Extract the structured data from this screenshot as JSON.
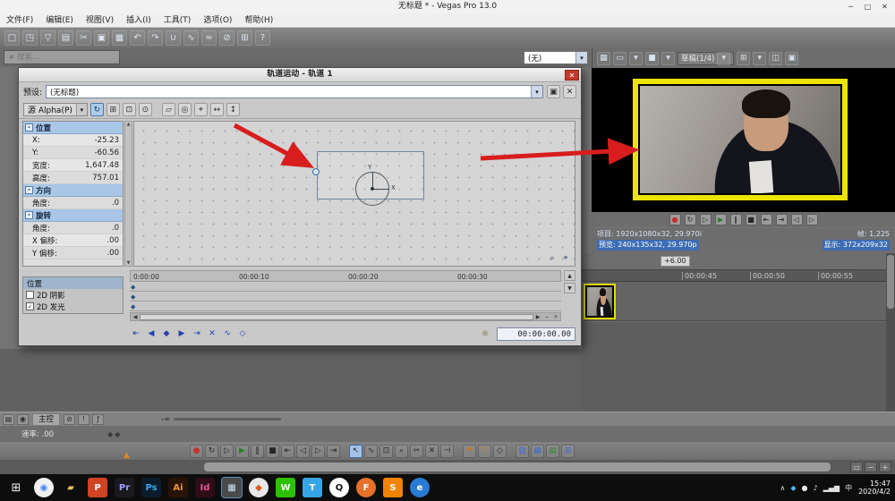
{
  "glyphs": {
    "dropdown": "▾",
    "check": "✓",
    "collapse": "-",
    "up": "▲",
    "down": "▼",
    "left": "◀",
    "right": "▶",
    "magnifier": "⌕",
    "pan": "⌖",
    "lamp": "☼",
    "box": "▭",
    "minus": "−",
    "plus": "+",
    "marker": "▲",
    "diamonds": "◆◆",
    "start": "⊞"
  },
  "window": {
    "title": "无标题 * - Vegas Pro 13.0",
    "controls": [
      {
        "name": "minimize-button",
        "t": "─",
        "cls": "winbtn"
      },
      {
        "name": "maximize-button",
        "t": "□",
        "cls": "winbtn"
      },
      {
        "name": "close-button",
        "t": "✕",
        "cls": "winbtn"
      }
    ],
    "menus": [
      {
        "name": "menu-file",
        "t": "文件(F)",
        "cls": "menu"
      },
      {
        "name": "menu-edit",
        "t": "编辑(E)",
        "cls": "menu"
      },
      {
        "name": "menu-view",
        "t": "视图(V)",
        "cls": "menu"
      },
      {
        "name": "menu-insert",
        "t": "插入(I)",
        "cls": "menu"
      },
      {
        "name": "menu-tools",
        "t": "工具(T)",
        "cls": "menu"
      },
      {
        "name": "menu-options",
        "t": "选项(O)",
        "cls": "menu"
      },
      {
        "name": "menu-help",
        "t": "帮助(H)",
        "cls": "menu"
      }
    ]
  },
  "main_toolbar": {
    "icons": [
      {
        "name": "new-project-icon",
        "t": "□"
      },
      {
        "name": "open-icon",
        "t": "◳"
      },
      {
        "name": "save-icon",
        "t": "▽"
      },
      {
        "name": "project-properties-icon",
        "t": "▤"
      },
      {
        "name": "cut-icon",
        "t": "✂"
      },
      {
        "name": "copy-icon",
        "t": "▣"
      },
      {
        "name": "paste-icon",
        "t": "▦"
      },
      {
        "name": "undo-icon",
        "t": "↶"
      },
      {
        "name": "redo-icon",
        "t": "↷"
      },
      {
        "name": "enable-snapping-icon",
        "t": "∪"
      },
      {
        "name": "auto-crossfade-icon",
        "t": "∿"
      },
      {
        "name": "auto-ripple-icon",
        "t": "≈"
      },
      {
        "name": "lock-envelopes-icon",
        "t": "⊘"
      },
      {
        "name": "ignore-grouping-icon",
        "t": "⊞"
      },
      {
        "name": "whats-this-help-icon",
        "t": "?"
      }
    ]
  },
  "subrow": {
    "search_placeholder": "搜索...",
    "none_dropdown": "(无)"
  },
  "dialog": {
    "title": "轨道运动 - 轨道 1",
    "close_glyph": "✕",
    "preset_label": "预设:",
    "preset_value": "(无标题)",
    "preset_icons": [
      {
        "name": "save-preset-icon",
        "t": "▣"
      },
      {
        "name": "delete-preset-icon",
        "t": "✕"
      }
    ],
    "alpha_combo": "源 Alpha(P)",
    "alpha_icons": [
      {
        "name": "sync-cursor-icon",
        "t": "↻",
        "cls": "on"
      },
      {
        "name": "prevent-movement-icon",
        "t": "⊞"
      },
      {
        "name": "prevent-scaling-icon",
        "t": "⊡"
      },
      {
        "name": "prevent-rotation-icon",
        "t": "⊙"
      },
      {
        "name": "separator",
        "t": "",
        "cls": "sep",
        "inter": false
      },
      {
        "name": "lock-aspect-ratio-icon",
        "t": "▱"
      },
      {
        "name": "scale-about-center-icon",
        "t": "◎"
      },
      {
        "name": "move-freely-icon",
        "t": "⌖"
      },
      {
        "name": "move-x-only-icon",
        "t": "↔"
      },
      {
        "name": "move-y-only-icon",
        "t": "↕"
      }
    ],
    "properties": [
      {
        "type": "header",
        "id": "position",
        "label": "位置"
      },
      {
        "type": "row",
        "label": "X:",
        "value": "-25.23"
      },
      {
        "type": "row",
        "label": "Y:",
        "value": "-60.56"
      },
      {
        "type": "row",
        "label": "宽度:",
        "value": "1,647.48"
      },
      {
        "type": "row",
        "label": "高度:",
        "value": "757.01"
      },
      {
        "type": "header",
        "id": "orientation",
        "label": "方向"
      },
      {
        "type": "row",
        "label": "角度:",
        "value": ".0"
      },
      {
        "type": "header",
        "id": "rotation",
        "label": "旋转"
      },
      {
        "type": "row",
        "label": "角度:",
        "value": ".0"
      },
      {
        "type": "row",
        "label": "X 偏移:",
        "value": ".00"
      },
      {
        "type": "row",
        "label": "Y 偏移:",
        "value": ".00"
      }
    ],
    "canvas": {
      "axis_y": "Y",
      "axis_x": "X"
    },
    "position_list": {
      "title": "位置",
      "items": [
        "2D 阴影",
        "2D 发光"
      ]
    },
    "ruler_ticks": [
      "0:00:00",
      "00:00:10",
      "00:00:20",
      "00:00:30"
    ],
    "keyframe_nav": [
      {
        "name": "go-to-first-keyframe-icon",
        "t": "⇤",
        "cls": "kf"
      },
      {
        "name": "previous-keyframe-icon",
        "t": "◀",
        "cls": "kf"
      },
      {
        "name": "insert-keyframe-icon",
        "t": "◆",
        "cls": "kf"
      },
      {
        "name": "next-keyframe-icon",
        "t": "▶",
        "cls": "kf"
      },
      {
        "name": "go-to-last-keyframe-icon",
        "t": "⇥",
        "cls": "kf"
      },
      {
        "name": "delete-keyframe-icon",
        "t": "✕",
        "cls": "kf"
      },
      {
        "name": "keyframe-interpolation-icon",
        "t": "∿",
        "cls": "kf"
      },
      {
        "name": "sync-keyframe-cursor-icon",
        "t": "◇",
        "cls": "kf"
      }
    ],
    "timecode": "00:00:00.00"
  },
  "preview": {
    "toolbar_icons_left": [
      {
        "name": "preview-device-icon",
        "t": "▦"
      },
      {
        "name": "video-output-icon",
        "t": "▭"
      },
      {
        "name": "output-dropdown-icon",
        "t": "▾"
      },
      {
        "name": "overlay-icon",
        "t": "■"
      },
      {
        "name": "overlay-dropdown-icon",
        "t": "▾"
      }
    ],
    "quality_label": "草稿(1/4)",
    "toolbar_icons_right": [
      {
        "name": "preview-grid-icon",
        "t": "⊞"
      },
      {
        "name": "grid-dropdown-icon",
        "t": "▾"
      },
      {
        "name": "split-screen-icon",
        "t": "◫"
      },
      {
        "name": "copy-snapshot-icon",
        "t": "▣"
      }
    ],
    "transport": [
      {
        "name": "record-button",
        "t": "●",
        "fg": "#c83030"
      },
      {
        "name": "loop-playback-button",
        "t": "↻"
      },
      {
        "name": "play-from-start-button",
        "t": "▷"
      },
      {
        "name": "play-button",
        "t": "▶",
        "fg": "#2e7d2e"
      },
      {
        "name": "pause-button",
        "t": "‖"
      },
      {
        "name": "stop-button",
        "t": "■"
      },
      {
        "name": "go-to-start-button",
        "t": "⇤"
      },
      {
        "name": "go-to-end-button",
        "t": "⇥"
      },
      {
        "name": "previous-frame-button",
        "t": "◁"
      },
      {
        "name": "next-frame-button",
        "t": "▷"
      }
    ],
    "info": {
      "project_label": "项目:",
      "project_value": "1920x1080x32, 29.970i",
      "frames_label": "帧:",
      "frames_value": "1,225",
      "preview_label": "预览:",
      "preview_value": "240x135x32, 29.970p",
      "display_label": "显示:",
      "display_value": "372x209x32"
    }
  },
  "timeline": {
    "offset_label": "+6.00",
    "ruler_ticks": [
      "00:00:45",
      "00:00:50",
      "00:00:55"
    ]
  },
  "bottom": {
    "master_icons": [
      {
        "name": "track-list-grid-icon",
        "t": "▤"
      },
      {
        "name": "bus-arm-icon",
        "t": "◉"
      }
    ],
    "master_label": "主控",
    "master_fx_icons": [
      {
        "name": "mute-icon",
        "t": "⊘"
      },
      {
        "name": "solo-icon",
        "t": "!"
      },
      {
        "name": "bus-fx-icon",
        "t": "ƒ"
      }
    ],
    "master_db": "-∞",
    "rate_label": "速率: .00",
    "transport": [
      {
        "name": "record-button",
        "t": "●",
        "fg": "#c83030"
      },
      {
        "name": "loop-playback-button",
        "t": "↻"
      },
      {
        "name": "play-from-start-button",
        "t": "▷"
      },
      {
        "name": "play-button",
        "t": "▶",
        "fg": "#2e7d2e"
      },
      {
        "name": "pause-button",
        "t": "‖"
      },
      {
        "name": "stop-button",
        "t": "■"
      },
      {
        "name": "go-to-start-button",
        "t": "⇤"
      },
      {
        "name": "previous-frame-button",
        "t": "◁"
      },
      {
        "name": "next-frame-button",
        "t": "▷"
      },
      {
        "name": "go-to-end-button",
        "t": "⇥"
      },
      {
        "name": "separator",
        "t": "",
        "cls": "sep",
        "inter": false
      },
      {
        "name": "normal-edit-tool-icon",
        "t": "↖",
        "cls": "on"
      },
      {
        "name": "envelope-edit-tool-icon",
        "t": "∿"
      },
      {
        "name": "selection-edit-tool-icon",
        "t": "⊡"
      },
      {
        "name": "zoom-edit-tool-icon",
        "t": "⌕"
      },
      {
        "name": "split-event-icon",
        "t": "✂"
      },
      {
        "name": "delete-event-icon",
        "t": "✕"
      },
      {
        "name": "trim-event-icon",
        "t": "⊣"
      },
      {
        "name": "separator",
        "t": "",
        "cls": "sep",
        "inter": false
      },
      {
        "name": "insert-marker-icon",
        "t": "⚑",
        "fg": "#c87820"
      },
      {
        "name": "insert-region-icon",
        "t": "▽",
        "fg": "#c87820"
      },
      {
        "name": "insert-command-icon",
        "t": "◇"
      },
      {
        "name": "separator",
        "t": "",
        "cls": "sep",
        "inter": false
      },
      {
        "name": "mixer-window-icon",
        "t": "▥",
        "fg": "#3c6cd0"
      },
      {
        "name": "video-preview-window-icon",
        "t": "▦",
        "fg": "#3c6cd0"
      },
      {
        "name": "master-bus-window-icon",
        "t": "▤",
        "fg": "#2e8a2e"
      },
      {
        "name": "plugin-manager-icon",
        "t": "⊞",
        "fg": "#3c6cd0"
      }
    ]
  },
  "taskbar": {
    "apps": [
      {
        "name": "taskbar-chrome-icon",
        "t": "◉",
        "bg": "#f1f1f1",
        "fg": "#4285f4",
        "cls": "round"
      },
      {
        "name": "taskbar-folder-icon",
        "t": "▰",
        "fg": "#e8c04a"
      },
      {
        "name": "taskbar-powerpoint-icon",
        "t": "P",
        "bg": "#d04423",
        "fg": "#ffffff"
      },
      {
        "name": "taskbar-premiere-icon",
        "t": "Pr",
        "bg": "#19191f",
        "fg": "#9f9fff"
      },
      {
        "name": "taskbar-photoshop-icon",
        "t": "Ps",
        "bg": "#0b1d2c",
        "fg": "#38a8e8"
      },
      {
        "name": "taskbar-illustrator-icon",
        "t": "Ai",
        "bg": "#271407",
        "fg": "#f09434"
      },
      {
        "name": "taskbar-indesign-icon",
        "t": "Id",
        "bg": "#2e0c18",
        "fg": "#e85590"
      },
      {
        "name": "taskbar-vegas-icon",
        "t": "▦",
        "bg": "#4a4a4a",
        "fg": "#cfe2f2",
        "cls": "active"
      },
      {
        "name": "taskbar-kmplayer-icon",
        "t": "◆",
        "bg": "#e8e8e8",
        "fg": "#e05a1a",
        "cls": "round"
      },
      {
        "name": "taskbar-wechat-icon",
        "t": "W",
        "bg": "#2dc100",
        "fg": "#ffffff"
      },
      {
        "name": "taskbar-tim-icon",
        "t": "T",
        "bg": "#36a5e5",
        "fg": "#ffffff"
      },
      {
        "name": "taskbar-qq-icon",
        "t": "Q",
        "bg": "#ffffff",
        "fg": "#111111",
        "cls": "round"
      },
      {
        "name": "taskbar-firefox-icon",
        "t": "F",
        "bg": "#e8702a",
        "fg": "#ffffff",
        "cls": "round"
      },
      {
        "name": "taskbar-sogou-icon",
        "t": "S",
        "bg": "#f08300",
        "fg": "#ffffff"
      },
      {
        "name": "taskbar-ie-icon",
        "t": "e",
        "bg": "#2a7bd4",
        "fg": "#ffffff",
        "cls": "round"
      }
    ],
    "tray": [
      {
        "name": "tray-expand-icon",
        "t": "∧"
      },
      {
        "name": "tray-app-icon",
        "t": "◆",
        "fg": "#58b0e8"
      },
      {
        "name": "tray-messenger-icon",
        "t": "●",
        "fg": "#e8e8e8"
      },
      {
        "name": "tray-volume-icon",
        "t": "♪"
      },
      {
        "name": "tray-network-icon",
        "t": "▂▄▆"
      },
      {
        "name": "tray-ime-icon",
        "t": "中"
      }
    ],
    "clock": {
      "time": "15:47",
      "date": "2020/4/2"
    }
  },
  "annotation": {
    "arrow_color": "#d81d1d"
  }
}
